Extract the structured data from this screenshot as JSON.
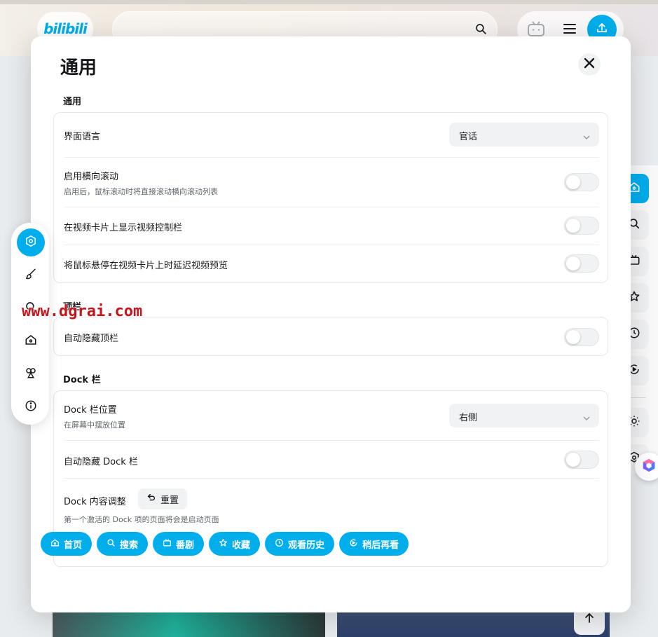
{
  "header": {
    "logo": "bilibili",
    "search_placeholder": ""
  },
  "modal": {
    "title": "通用",
    "sections": {
      "general": {
        "title": "通用",
        "language_label": "界面语言",
        "language_value": "官话",
        "hscroll_label": "启用横向滚动",
        "hscroll_desc": "启用后，鼠标滚动时将直接滚动横向滚动列表",
        "hscroll_on": false,
        "video_controls_label": "在视频卡片上显示视频控制栏",
        "video_controls_on": false,
        "hover_preview_label": "将鼠标悬停在视频卡片上时延迟视频预览",
        "hover_preview_on": false
      },
      "topbar": {
        "title": "顶栏",
        "autohide_label": "自动隐藏顶栏",
        "autohide_on": false
      },
      "dock": {
        "title": "Dock 栏",
        "position_label": "Dock 栏位置",
        "position_desc": "在屏幕中摆放位置",
        "position_value": "右侧",
        "autohide_label": "自动隐藏 Dock 栏",
        "autohide_on": false,
        "content_label": "Dock 内容调整",
        "reset_label": "重置",
        "content_desc": "第一个激活的 Dock 项的页面将会是启动页面",
        "items": [
          {
            "label": "首页",
            "icon": "home-icon"
          },
          {
            "label": "搜索",
            "icon": "search-icon"
          },
          {
            "label": "番剧",
            "icon": "tv-icon"
          },
          {
            "label": "收藏",
            "icon": "star-icon"
          },
          {
            "label": "观看历史",
            "icon": "clock-icon"
          },
          {
            "label": "稍后再看",
            "icon": "watch-later-icon"
          }
        ]
      }
    }
  },
  "left_nav": [
    {
      "name": "settings",
      "icon": "gear-icon",
      "active": true
    },
    {
      "name": "appearance",
      "icon": "brush-icon",
      "active": false
    },
    {
      "name": "search",
      "icon": "search-icon",
      "active": false
    },
    {
      "name": "home",
      "icon": "home-icon",
      "active": false
    },
    {
      "name": "plugins",
      "icon": "shapes-icon",
      "active": false
    },
    {
      "name": "about",
      "icon": "info-icon",
      "active": false
    }
  ],
  "watermark": "www.dgrai.com",
  "colors": {
    "accent": "#00aeec",
    "text": "#18191c",
    "subtext": "#61666d",
    "control_bg": "#f1f2f3",
    "watermark": "#c4161c"
  }
}
